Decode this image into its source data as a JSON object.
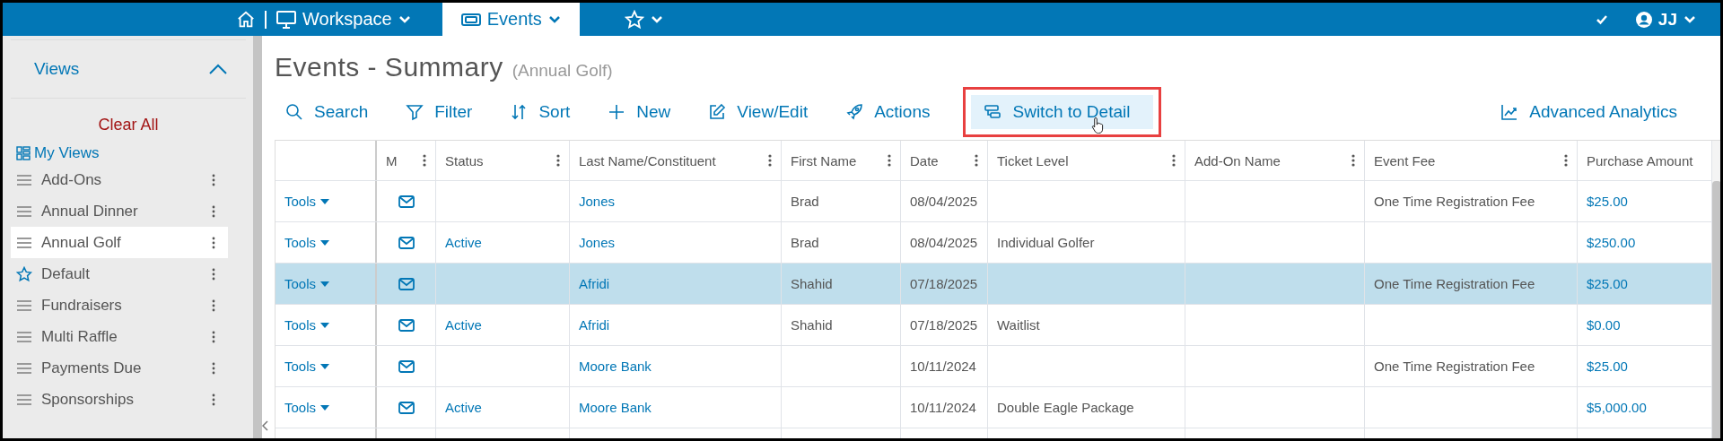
{
  "top_nav": {
    "items": [
      {
        "kind": "home",
        "selected": false
      },
      {
        "kind": "workspace",
        "label": "Workspace",
        "selected": false
      },
      {
        "kind": "events",
        "label": "Events",
        "selected": true
      },
      {
        "kind": "favorites",
        "selected": false
      }
    ],
    "user": {
      "initials": "JJ"
    }
  },
  "sidebar": {
    "title": "Views",
    "clear_label": "Clear All",
    "my_views_label": "My Views",
    "items": [
      {
        "label": "Add-Ons",
        "kind": "list",
        "selected": false
      },
      {
        "label": "Annual Dinner",
        "kind": "list",
        "selected": false
      },
      {
        "label": "Annual Golf",
        "kind": "list",
        "selected": true
      },
      {
        "label": "Default",
        "kind": "star",
        "selected": false
      },
      {
        "label": "Fundraisers",
        "kind": "list",
        "selected": false
      },
      {
        "label": "Multi Raffle",
        "kind": "list",
        "selected": false
      },
      {
        "label": "Payments Due",
        "kind": "list",
        "selected": false
      },
      {
        "label": "Sponsorships",
        "kind": "list",
        "selected": false
      }
    ]
  },
  "page": {
    "title": "Events - Summary",
    "subtitle": "(Annual Golf)"
  },
  "toolbar": {
    "items": [
      {
        "kind": "search",
        "label": "Search",
        "highlighted": false
      },
      {
        "kind": "filter",
        "label": "Filter",
        "highlighted": false
      },
      {
        "kind": "sort",
        "label": "Sort",
        "highlighted": false
      },
      {
        "kind": "new",
        "label": "New",
        "highlighted": false
      },
      {
        "kind": "edit",
        "label": "View/Edit",
        "highlighted": false
      },
      {
        "kind": "actions",
        "label": "Actions",
        "highlighted": false
      },
      {
        "kind": "detail",
        "label": "Switch to Detail",
        "highlighted": true
      }
    ],
    "analytics": {
      "label": "Advanced Analytics"
    }
  },
  "table": {
    "columns": [
      {
        "label": "M",
        "kind": "mail",
        "menu": true
      },
      {
        "label": "Status",
        "kind": "link",
        "menu": true
      },
      {
        "label": "Last Name/Constituent",
        "kind": "link",
        "menu": true
      },
      {
        "label": "First Name",
        "kind": "text",
        "menu": true
      },
      {
        "label": "Date",
        "kind": "text",
        "menu": true
      },
      {
        "label": "Ticket Level",
        "kind": "text",
        "menu": true
      },
      {
        "label": "Add-On Name",
        "kind": "text",
        "menu": true
      },
      {
        "label": "Event Fee",
        "kind": "text",
        "menu": true
      },
      {
        "label": "Purchase Amount",
        "kind": "link",
        "menu": false
      }
    ],
    "rows": [
      {
        "tools": "Tools",
        "selected": false,
        "cells": [
          null,
          null,
          "Jones",
          "Brad",
          "08/04/2025",
          null,
          null,
          "One Time Registration Fee",
          "$25.00"
        ]
      },
      {
        "tools": "Tools",
        "selected": false,
        "cells": [
          null,
          "Active",
          "Jones",
          "Brad",
          "08/04/2025",
          "Individual Golfer",
          null,
          null,
          "$250.00"
        ]
      },
      {
        "tools": "Tools",
        "selected": true,
        "cells": [
          null,
          null,
          "Afridi",
          "Shahid",
          "07/18/2025",
          null,
          null,
          "One Time Registration Fee",
          "$25.00"
        ]
      },
      {
        "tools": "Tools",
        "selected": false,
        "cells": [
          null,
          "Active",
          "Afridi",
          "Shahid",
          "07/18/2025",
          "Waitlist",
          null,
          null,
          "$0.00"
        ]
      },
      {
        "tools": "Tools",
        "selected": false,
        "cells": [
          null,
          null,
          "Moore Bank",
          null,
          "10/11/2024",
          null,
          null,
          "One Time Registration Fee",
          "$25.00"
        ]
      },
      {
        "tools": "Tools",
        "selected": false,
        "cells": [
          null,
          "Active",
          "Moore Bank",
          null,
          "10/11/2024",
          "Double Eagle Package",
          null,
          null,
          "$5,000.00"
        ]
      }
    ]
  }
}
